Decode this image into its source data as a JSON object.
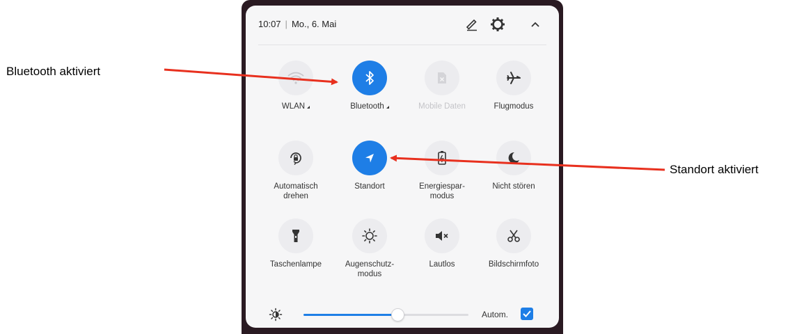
{
  "callouts": {
    "bluetooth": "Bluetooth aktiviert",
    "location": "Standort aktiviert"
  },
  "header": {
    "time": "10:07",
    "date": "Mo., 6. Mai",
    "icons": [
      "edit-icon",
      "gear-icon",
      "chevron-up-icon"
    ]
  },
  "tiles": [
    {
      "label": "WLAN",
      "icon": "wifi-icon",
      "active": false,
      "dropdown": true
    },
    {
      "label": "Bluetooth",
      "icon": "bluetooth-icon",
      "active": true,
      "dropdown": true
    },
    {
      "label": "Mobile Daten",
      "icon": "mobile-data-icon",
      "active": false,
      "disabled": true
    },
    {
      "label": "Flugmodus",
      "icon": "airplane-icon",
      "active": false
    },
    {
      "label": "Automatisch\ndrehen",
      "icon": "auto-rotate-icon",
      "active": false
    },
    {
      "label": "Standort",
      "icon": "location-icon",
      "active": true
    },
    {
      "label": "Energiespar-\nmodus",
      "icon": "battery-icon",
      "active": false
    },
    {
      "label": "Nicht stören",
      "icon": "moon-icon",
      "active": false
    },
    {
      "label": "Taschenlampe",
      "icon": "flashlight-icon",
      "active": false
    },
    {
      "label": "Augenschutz-\nmodus",
      "icon": "eye-comfort-icon",
      "active": false
    },
    {
      "label": "Lautlos",
      "icon": "mute-icon",
      "active": false
    },
    {
      "label": "Bildschirmfoto",
      "icon": "scissors-icon",
      "active": false
    }
  ],
  "brightness": {
    "level": 0.57,
    "auto_label": "Autom.",
    "auto_checked": true
  },
  "colors": {
    "accent": "#1e7ee6",
    "arrow": "#e8301e",
    "tile_inactive": "#ececef"
  }
}
